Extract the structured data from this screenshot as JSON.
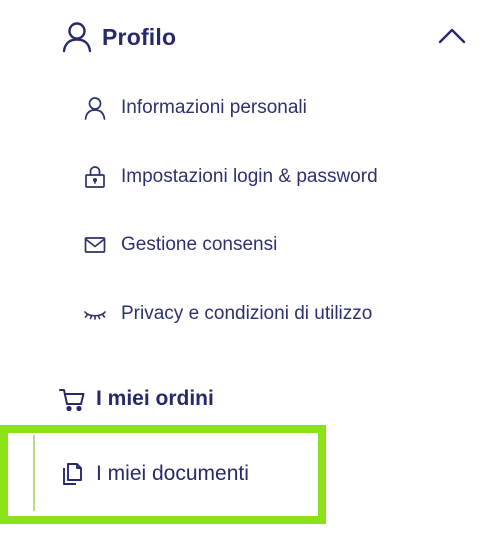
{
  "menu": {
    "profile": {
      "label": "Profilo",
      "icon": "user-icon",
      "expanded": true
    },
    "profile_items": [
      {
        "label": "Informazioni personali",
        "icon": "user-icon"
      },
      {
        "label": "Impostazioni login & password",
        "icon": "lock-icon"
      },
      {
        "label": "Gestione consensi",
        "icon": "envelope-icon"
      },
      {
        "label": "Privacy e condizioni di utilizzo",
        "icon": "eye-closed-icon"
      }
    ],
    "orders": {
      "label": "I miei ordini",
      "icon": "cart-icon"
    },
    "documents": {
      "label": "I miei documenti",
      "icon": "documents-icon",
      "active": true
    }
  },
  "colors": {
    "text": "#262a6b",
    "highlight": "#8ce21a",
    "active_bar": "#b6dc8a",
    "background": "#ffffff"
  }
}
